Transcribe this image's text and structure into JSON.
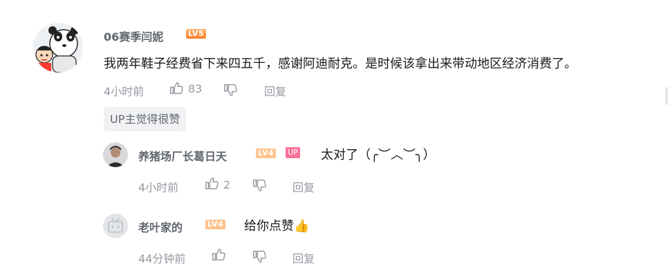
{
  "comment": {
    "username": "06赛季闫妮",
    "level": "LV5",
    "text": "我两年鞋子经费省下来四五千，感谢阿迪耐克。是时候该拿出来带动地区经济消费了。",
    "time": "4小时前",
    "likes": "83",
    "reply_label": "回复",
    "up_liked_label": "UP主觉得很赞"
  },
  "replies": [
    {
      "username": "养猪场厂长葛日天",
      "level": "LV4",
      "up_tag": "UP",
      "text": "太对了（╭︶︿︶╮）",
      "time": "4小时前",
      "likes": "2",
      "reply_label": "回复"
    },
    {
      "username": "老叶家的",
      "level": "LV4",
      "text": "给你点赞👍",
      "time": "44分钟前",
      "reply_label": "回复"
    }
  ],
  "colors": {
    "up_pink": "#fb7299",
    "level_orange": "#ff9f43",
    "meta_gray": "#9499a0"
  }
}
